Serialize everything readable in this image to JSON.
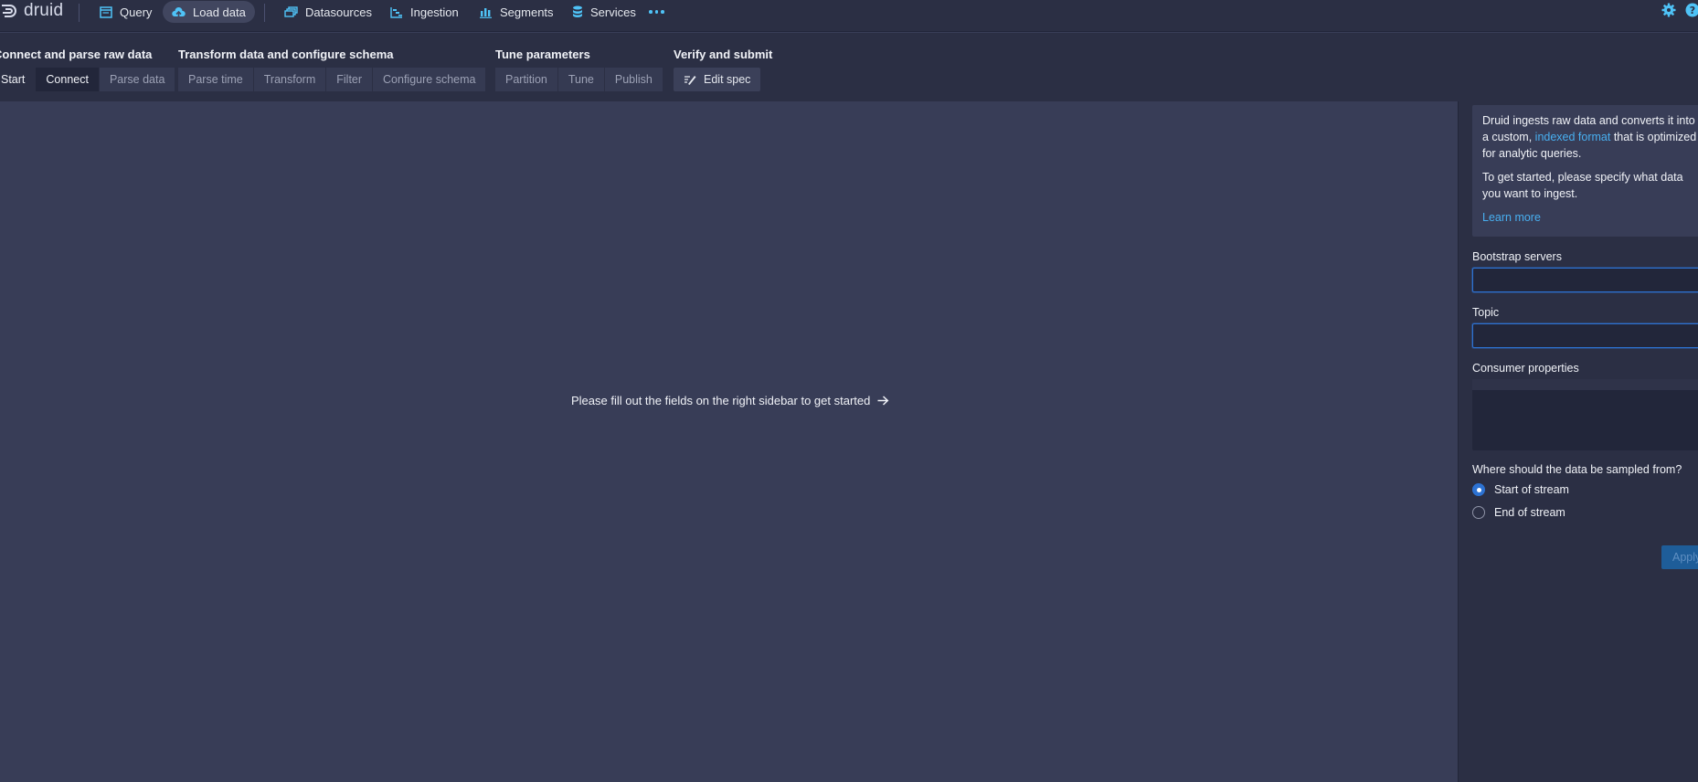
{
  "app": {
    "logo_text": "druid"
  },
  "nav": {
    "items": [
      {
        "label": "Query",
        "icon": "application-icon"
      },
      {
        "label": "Load data",
        "icon": "cloud-upload-icon",
        "active": true
      },
      {
        "label": "Datasources",
        "icon": "multi-select-icon"
      },
      {
        "label": "Ingestion",
        "icon": "gantt-chart-icon"
      },
      {
        "label": "Segments",
        "icon": "stacked-chart-icon"
      },
      {
        "label": "Services",
        "icon": "database-icon"
      }
    ],
    "more_icon": "more-icon",
    "right_icons": [
      "cog-icon",
      "help-icon"
    ]
  },
  "steps": {
    "groups": [
      {
        "title": "Connect and parse raw data",
        "buttons": [
          "Start",
          "Connect",
          "Parse data"
        ]
      },
      {
        "title": "Transform data and configure schema",
        "buttons": [
          "Parse time",
          "Transform",
          "Filter",
          "Configure schema"
        ]
      },
      {
        "title": "Tune parameters",
        "buttons": [
          "Partition",
          "Tune",
          "Publish"
        ]
      },
      {
        "title": "Verify and submit",
        "buttons": [
          "Edit spec"
        ]
      }
    ],
    "current": "Connect"
  },
  "main": {
    "empty_message": "Please fill out the fields on the right sidebar to get started",
    "arrow_icon": "arrow-right-icon"
  },
  "sidebar": {
    "intro": {
      "p1_before": "Druid ingests raw data and converts it into a custom, ",
      "p1_link": "indexed format",
      "p1_after": " that is optimized for analytic queries.",
      "p2": "To get started, please specify what data you want to ingest.",
      "learn_more": "Learn more"
    },
    "bootstrap_servers": {
      "label": "Bootstrap servers",
      "value": ""
    },
    "topic": {
      "label": "Topic",
      "value": ""
    },
    "consumer_properties": {
      "label": "Consumer properties",
      "value": ""
    },
    "sample_from": {
      "label": "Where should the data be sampled from?",
      "options": [
        "Start of stream",
        "End of stream"
      ],
      "selected": "Start of stream"
    },
    "apply_label": "Apply"
  },
  "colors": {
    "accent": "#4fc3f7",
    "link": "#48aff0",
    "primary": "#2d72d2",
    "background": "#383d57",
    "panel": "#2b2f44"
  }
}
